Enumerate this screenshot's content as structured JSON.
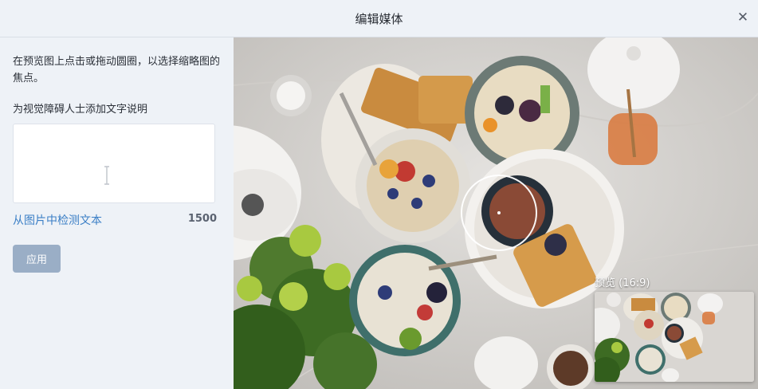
{
  "header": {
    "title": "编辑媒体"
  },
  "sidebar": {
    "hint": "在预览图上点击或拖动圆圈，以选择缩略图的焦点。",
    "alt_label": "为视觉障碍人士添加文字说明",
    "alt_value": "",
    "detect_link": "从图片中检测文本",
    "char_count": "1500",
    "apply_label": "应用"
  },
  "preview": {
    "label": "预览 (16:9)"
  },
  "icons": {
    "close": "close-icon",
    "ibeam": "text-cursor-icon"
  },
  "colors": {
    "link": "#3b7fc6",
    "button": "#9aaec6",
    "panel": "#eef2f7"
  }
}
